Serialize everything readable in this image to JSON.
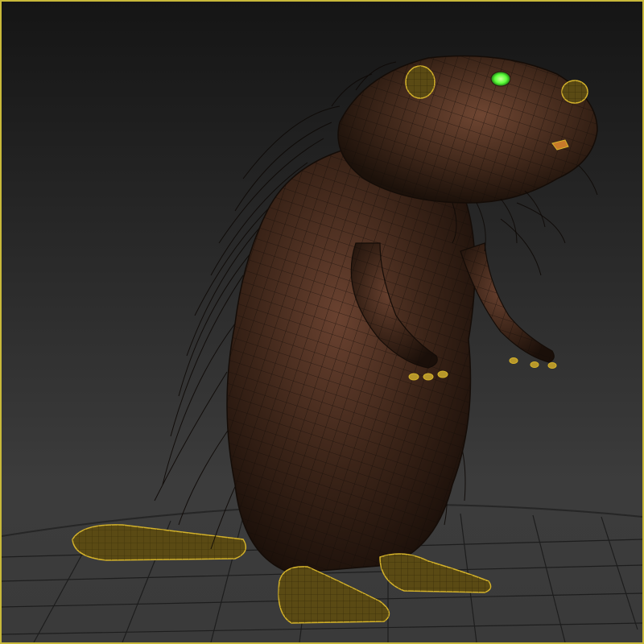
{
  "viewport": {
    "border_color": "#c8b93a",
    "background_top": "#151515",
    "background_bottom": "#3c3c3c"
  },
  "scene": {
    "grid_color": "#1d1d1d",
    "fur_color": "#3b2418",
    "fur_highlight": "#6a4230",
    "wireframe_color": "#1a120c",
    "selection_wire_color": "#d4b22a",
    "eye_glow_color": "#5cff3a"
  }
}
